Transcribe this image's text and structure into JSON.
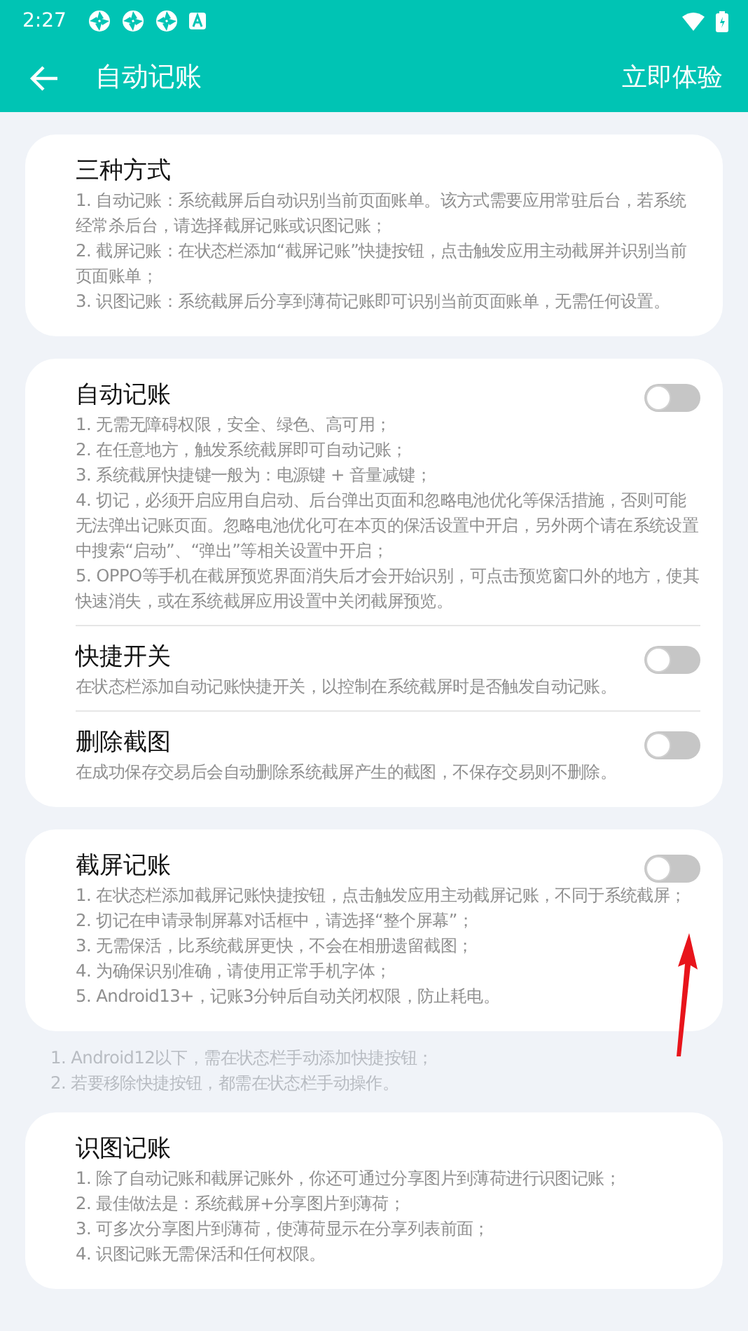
{
  "status_bar": {
    "time": "2:27"
  },
  "app_bar": {
    "title": "自动记账",
    "action": "立即体验"
  },
  "blocks": [
    {
      "kind": "card",
      "sections": [
        {
          "title": "三种方式",
          "lines": [
            "1. 自动记账：系统截屏后自动识别当前页面账单。该方式需要应用常驻后台，若系统经常杀后台，请选择截屏记账或识图记账；",
            "2. 截屏记账：在状态栏添加“截屏记账”快捷按钮，点击触发应用主动截屏并识别当前页面账单；",
            "3. 识图记账：系统截屏后分享到薄荷记账即可识别当前页面账单，无需任何设置。"
          ]
        }
      ]
    },
    {
      "kind": "card",
      "sections": [
        {
          "title": "自动记账",
          "on": false,
          "lines": [
            "1. 无需无障碍权限，安全、绿色、高可用；",
            "2. 在任意地方，触发系统截屏即可自动记账；",
            "3. 系统截屏快捷键一般为：电源键 + 音量减键；",
            "4. 切记，必须开启应用自启动、后台弹出页面和忽略电池优化等保活措施，否则可能无法弹出记账页面。忽略电池优化可在本页的保活设置中开启，另外两个请在系统设置中搜索“启动”、“弹出”等相关设置中开启；",
            "5. OPPO等手机在截屏预览界面消失后才会开始识别，可点击预览窗口外的地方，使其快速消失，或在系统截屏应用设置中关闭截屏预览。"
          ]
        },
        {
          "title": "快捷开关",
          "on": false,
          "lines": [
            "在状态栏添加自动记账快捷开关，以控制在系统截屏时是否触发自动记账。"
          ]
        },
        {
          "title": "删除截图",
          "on": false,
          "lines": [
            "在成功保存交易后会自动删除系统截屏产生的截图，不保存交易则不删除。"
          ]
        }
      ]
    },
    {
      "kind": "card",
      "sections": [
        {
          "title": "截屏记账",
          "on": false,
          "lines": [
            "1. 在状态栏添加截屏记账快捷按钮，点击触发应用主动截屏记账，不同于系统截屏；",
            "2. 切记在申请录制屏幕对话框中，请选择“整个屏幕”；",
            "3. 无需保活，比系统截屏更快，不会在相册遗留截图；",
            "4. 为确保识别准确，请使用正常手机字体；",
            "5. Android13+，记账3分钟后自动关闭权限，防止耗电。"
          ]
        }
      ]
    },
    {
      "kind": "notes",
      "lines": [
        "1. Android12以下，需在状态栏手动添加快捷按钮；",
        "2. 若要移除快捷按钮，都需在状态栏手动操作。"
      ]
    },
    {
      "kind": "card",
      "sections": [
        {
          "title": "识图记账",
          "lines": [
            "1. 除了自动记账和截屏记账外，你还可通过分享图片到薄荷进行识图记账；",
            "2. 最佳做法是：系统截屏+分享图片到薄荷；",
            "3. 可多次分享图片到薄荷，使薄荷显示在分享列表前面；",
            "4. 识图记账无需保活和任何权限。"
          ]
        }
      ]
    }
  ]
}
